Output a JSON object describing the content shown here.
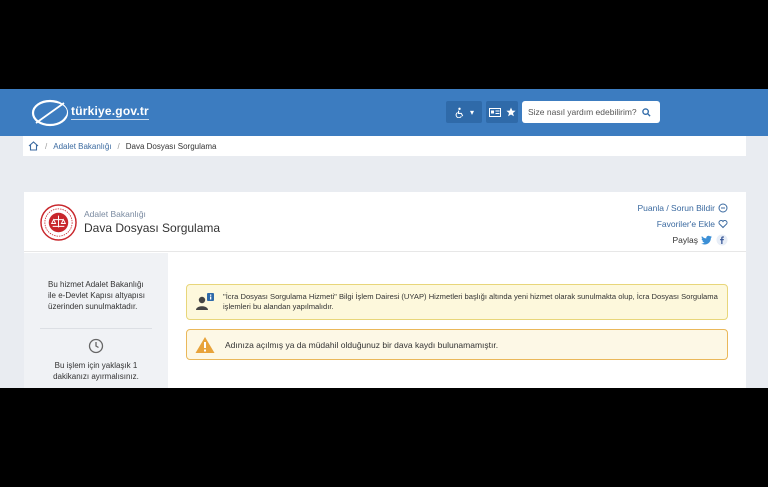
{
  "header": {
    "logo_text": "türkiye.gov.tr",
    "search_placeholder": "Size nasıl yardım edebilirim?",
    "accessibility_caret": "▾",
    "brand_color": "#3c7cc0"
  },
  "breadcrumb": {
    "items": [
      "Adalet Bakanlığı",
      "Dava Dosyası Sorgulama"
    ]
  },
  "service": {
    "institution": "Adalet Bakanlığı",
    "title": "Dava Dosyası Sorgulama",
    "links": {
      "rate": "Puanla / Sorun Bildir",
      "favorite": "Favoriler'e Ekle",
      "share": "Paylaş"
    }
  },
  "sidebar": {
    "info": "Bu hizmet Adalet Bakanlığı ile e-Devlet Kapısı altyapısı üzerinden sunulmaktadır.",
    "time": "Bu işlem için yaklaşık 1 dakikanızı ayırmalısınız."
  },
  "alerts": {
    "info": "\"İcra Dosyası Sorgulama Hizmeti\" Bilgi İşlem Dairesi (UYAP) Hizmetleri başlığı altında yeni hizmet olarak sunulmakta olup, İcra Dosyası Sorgulama işlemleri bu alandan yapılmalıdır.",
    "warning": "Adınıza açılmış ya da müdahil olduğunuz bir dava kaydı bulunamamıştır."
  }
}
